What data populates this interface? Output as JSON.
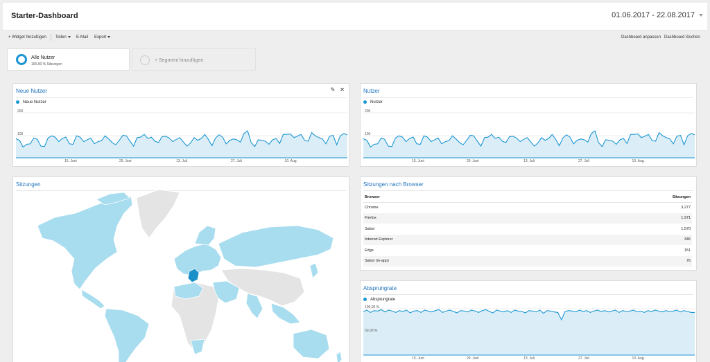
{
  "header": {
    "title": "Starter-Dashboard",
    "date_range": "01.06.2017 - 22.08.2017"
  },
  "actions": {
    "add_widget": "+ Widget hinzufügen",
    "share": "Teilen",
    "email": "E-Mail",
    "export": "Export",
    "customize": "Dashboard anpassen",
    "delete": "Dashboard löschen"
  },
  "segments": {
    "active_name": "Alle Nutzer",
    "active_sub": "100,00 % Sitzungen",
    "add_label": "+ Segment hinzufügen"
  },
  "widgets": {
    "new_users": {
      "title": "Neue Nutzer",
      "legend": "Neue Nutzer"
    },
    "users": {
      "title": "Nutzer",
      "legend": "Nutzer"
    },
    "sessions": {
      "title": "Sitzungen"
    },
    "browsers": {
      "title": "Sitzungen nach Browser",
      "col_browser": "Browser",
      "col_sessions": "Sitzungen"
    },
    "bounce": {
      "title": "Absprungrate",
      "legend": "Absprungrate"
    }
  },
  "icons": {
    "edit": "pencil-icon",
    "close": "close-icon"
  },
  "colors": {
    "accent": "#1b96d2",
    "title": "#1e73be",
    "area": "#dbeef8",
    "map_data": "#a8dcef",
    "map_highlight": "#1a8fc9",
    "map_empty": "#e4e4e4"
  },
  "chart_data": [
    {
      "type": "area",
      "name": "Neue Nutzer",
      "y_ticks": [
        "200",
        "100"
      ],
      "ylim": [
        0,
        200
      ],
      "x_ticks": [
        "15. Juni",
        "29. Juni",
        "13. Juli",
        "27. Juli",
        "10. Aug."
      ],
      "series": [
        {
          "name": "Neue Nutzer",
          "values": [
            85,
            78,
            48,
            60,
            62,
            88,
            82,
            52,
            50,
            88,
            98,
            92,
            72,
            86,
            92,
            62,
            60,
            98,
            92,
            72,
            80,
            88,
            62,
            72,
            76,
            98,
            84,
            68,
            58,
            78,
            100,
            98,
            74,
            52,
            90,
            92,
            104,
            86,
            92,
            74,
            68,
            94,
            96,
            88,
            72,
            82,
            90,
            70,
            52,
            66,
            90,
            78,
            86,
            104,
            82,
            54,
            88,
            102,
            92,
            62,
            78,
            84,
            80,
            70,
            108,
            120,
            68,
            50,
            80,
            78,
            74,
            60,
            80,
            86,
            64,
            104,
            104,
            106,
            90,
            96,
            104,
            78,
            74,
            112,
            98,
            90,
            84,
            62,
            96,
            100,
            58,
            98,
            108,
            102
          ]
        }
      ]
    },
    {
      "type": "area",
      "name": "Nutzer",
      "y_ticks": [
        "200",
        "100"
      ],
      "ylim": [
        0,
        200
      ],
      "x_ticks": [
        "15. Juni",
        "29. Juni",
        "13. Juli",
        "27. Juli",
        "10. Aug."
      ],
      "series": [
        {
          "name": "Nutzer",
          "values": [
            85,
            78,
            48,
            60,
            62,
            88,
            82,
            52,
            50,
            88,
            98,
            92,
            72,
            86,
            92,
            62,
            60,
            98,
            92,
            72,
            80,
            88,
            62,
            72,
            76,
            98,
            84,
            68,
            58,
            78,
            100,
            98,
            74,
            52,
            90,
            92,
            104,
            86,
            92,
            74,
            68,
            94,
            96,
            88,
            72,
            82,
            90,
            70,
            52,
            66,
            90,
            78,
            86,
            104,
            82,
            54,
            88,
            102,
            92,
            62,
            78,
            84,
            80,
            70,
            108,
            120,
            68,
            50,
            80,
            78,
            74,
            60,
            80,
            86,
            64,
            104,
            104,
            106,
            90,
            96,
            104,
            78,
            74,
            112,
            98,
            90,
            84,
            62,
            96,
            100,
            58,
            98,
            108,
            102
          ]
        }
      ]
    },
    {
      "type": "area",
      "name": "Absprungrate",
      "y_ticks": [
        "100,00 %",
        "50,00 %"
      ],
      "ylim": [
        0,
        100
      ],
      "x_ticks": [
        "15. Juni",
        "29. Juni",
        "13. Juli",
        "27. Juli",
        "10. Aug."
      ],
      "series": [
        {
          "name": "Absprungrate",
          "values": [
            94,
            97,
            92,
            96,
            95,
            98,
            93,
            97,
            95,
            92,
            96,
            94,
            97,
            91,
            95,
            96,
            92,
            97,
            95,
            93,
            96,
            98,
            92,
            95,
            97,
            94,
            91,
            96,
            95,
            93,
            97,
            95,
            92,
            96,
            98,
            94,
            91,
            97,
            95,
            93,
            96,
            92,
            97,
            95,
            94,
            91,
            96,
            95,
            93,
            97,
            90,
            96,
            95,
            93,
            92,
            76,
            94,
            96,
            95,
            93,
            97,
            94,
            96,
            92,
            95,
            97,
            94,
            96,
            93,
            95,
            97,
            92,
            96,
            94,
            95,
            97,
            93,
            95,
            92,
            96,
            94,
            97,
            95,
            93,
            96,
            94,
            95,
            97,
            93,
            96,
            94,
            92,
            92
          ]
        }
      ]
    },
    {
      "type": "table",
      "name": "Sitzungen nach Browser",
      "columns": [
        "Browser",
        "Sitzungen"
      ],
      "rows": [
        [
          "Chrome",
          "3.277"
        ],
        [
          "Firefox",
          "1.971"
        ],
        [
          "Safari",
          "1.570"
        ],
        [
          "Internet Explorer",
          "346"
        ],
        [
          "Edge",
          "151"
        ],
        [
          "Safari (in-app)",
          "76"
        ]
      ]
    }
  ]
}
